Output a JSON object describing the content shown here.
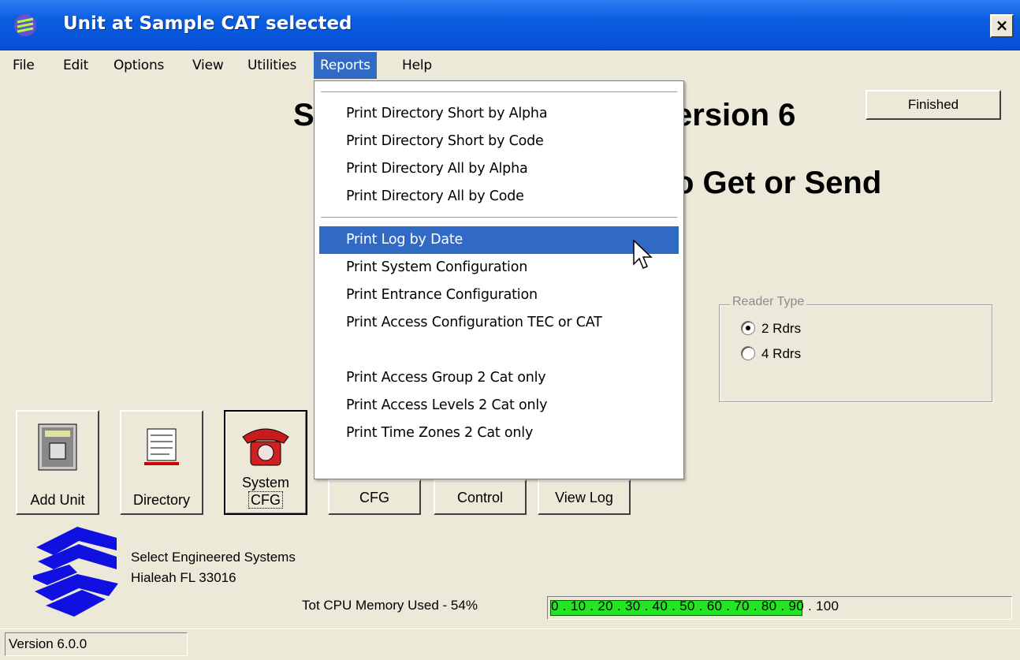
{
  "window": {
    "title": "Unit at Sample CAT selected",
    "close_label": "×"
  },
  "menubar": {
    "items": [
      "File",
      "Edit",
      "Options",
      "View",
      "Utilities",
      "Reports",
      "Help"
    ],
    "active": "Reports"
  },
  "main": {
    "heading1_left": "S",
    "heading1_right": "ersion 6",
    "heading2_right": "o Get or Send",
    "finished_label": "Finished"
  },
  "reader_type": {
    "legend": "Reader Type",
    "options": [
      {
        "label": "2 Rdrs",
        "selected": true
      },
      {
        "label": "4 Rdrs",
        "selected": false
      }
    ]
  },
  "reports_menu": {
    "items": [
      "Print Directory Short by Alpha",
      "Print Directory Short by Code",
      "Print Directory All by Alpha",
      "Print Directory All by Code",
      "Print Log by Date",
      "Print System Configuration",
      "Print Entrance Configuration",
      "Print Access Configuration TEC or CAT",
      "Print Access Group 2 Cat only",
      "Print Access Levels 2 Cat only",
      "Print Time Zones 2 Cat only"
    ],
    "highlighted": "Print Log by Date"
  },
  "toolbar": {
    "add_unit": "Add Unit",
    "directory": "Directory",
    "system_cfg_line1": "System",
    "system_cfg_line2": "CFG",
    "entrance_cfg": "CFG",
    "access_control": "Control",
    "view_log": "View Log"
  },
  "company": {
    "name": "Select Engineered Systems",
    "address": "Hialeah FL 33016"
  },
  "memory": {
    "label": "Tot CPU Memory Used - 54%",
    "percent": 54,
    "scale": "0 . 10 . 20 . 30 . 40 . 50 . 60 . 70 . 80 . 90 . 100"
  },
  "status": {
    "version": "Version 6.0.0"
  },
  "colors": {
    "title_blue": "#0a5de0",
    "menu_highlight": "#316ac5",
    "memory_fill": "#22e622",
    "window_bg": "#ece9d8"
  }
}
